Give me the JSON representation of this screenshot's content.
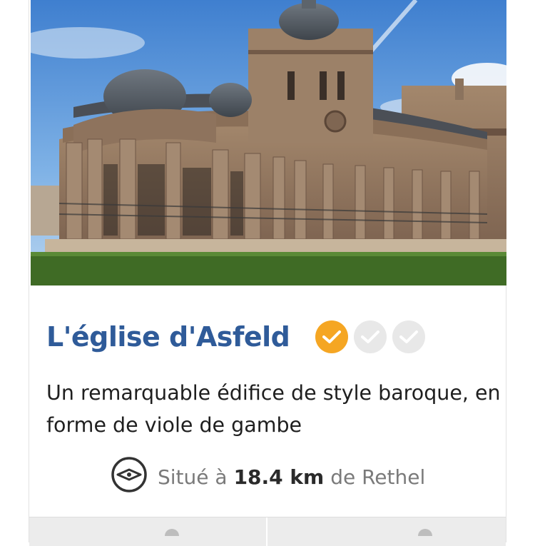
{
  "place": {
    "title": "L'église d'Asfeld",
    "description": "Un remarquable édifice de style baroque, en forme de viole de gambe",
    "distance_prefix": "Situé à",
    "distance_value": "18.4 km",
    "distance_suffix": "de Rethel"
  },
  "rating": {
    "checked": 1,
    "total": 3
  },
  "colors": {
    "title": "#2f5b99",
    "check_on": "#f5a623",
    "check_off": "#e8e8e8",
    "sky": "#4d8fd6",
    "grass": "#3f6b25"
  },
  "icons": {
    "compass": "compass-icon",
    "check": "checkmark-icon"
  }
}
